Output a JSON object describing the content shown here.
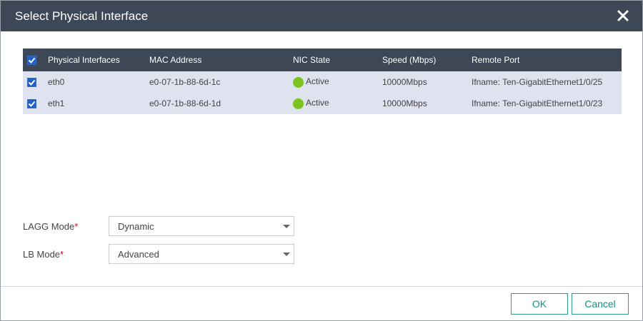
{
  "dialog": {
    "title": "Select Physical Interface",
    "close_icon": "close-icon"
  },
  "table": {
    "select_all_checked": true,
    "columns": [
      "Physical Interfaces",
      "MAC Address",
      "NIC State",
      "Speed (Mbps)",
      "Remote Port"
    ],
    "rows": [
      {
        "checked": true,
        "name": "eth0",
        "mac": "e0-07-1b-88-6d-1c",
        "state": "Active",
        "speed": "10000Mbps",
        "remote_port": "Ifname: Ten-GigabitEthernet1/0/25"
      },
      {
        "checked": true,
        "name": "eth1",
        "mac": "e0-07-1b-88-6d-1d",
        "state": "Active",
        "speed": "10000Mbps",
        "remote_port": "Ifname: Ten-GigabitEthernet1/0/23"
      }
    ],
    "state_color": "#7dc21e"
  },
  "form": {
    "lagg_mode": {
      "label": "LAGG Mode",
      "required_mark": "*",
      "value": "Dynamic"
    },
    "lb_mode": {
      "label": "LB Mode",
      "required_mark": "*",
      "value": "Advanced"
    }
  },
  "buttons": {
    "ok_label": "OK",
    "cancel_label": "Cancel"
  },
  "colors": {
    "header_bg": "#3e4756",
    "row_bg": "#dfe3f0",
    "accent": "#1f8f82"
  }
}
